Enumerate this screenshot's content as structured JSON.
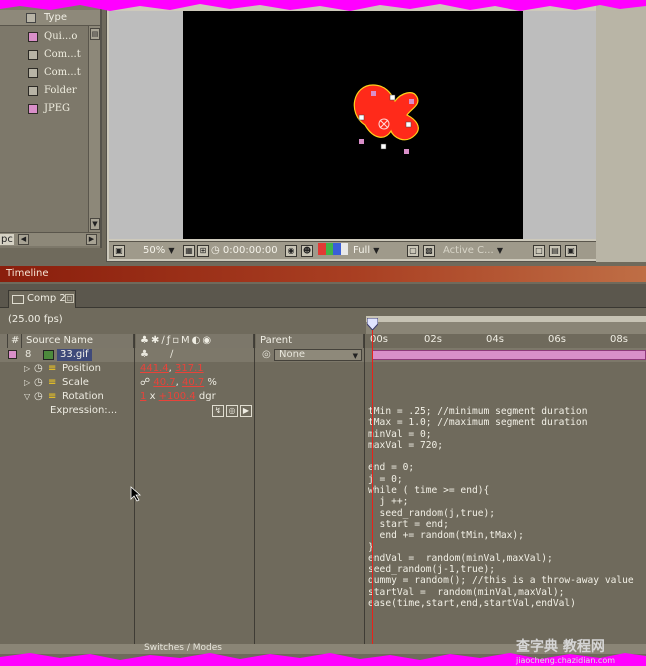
{
  "project": {
    "header_label": "Type",
    "items": [
      {
        "label": "Qui...o",
        "color": "#d98fc9"
      },
      {
        "label": "Com...t",
        "color": "#b7b3a5"
      },
      {
        "label": "Com...t",
        "color": "#b7b3a5"
      },
      {
        "label": "Folder",
        "color": "#b7b3a5"
      },
      {
        "label": "JPEG",
        "color": "#d98fc9"
      }
    ],
    "hscroll_text": "pc"
  },
  "viewer": {
    "zoom": "50%",
    "timecode": "0:00:00:00",
    "resolution": "Full",
    "camera": "Active C..."
  },
  "timeline": {
    "panel_title": "Timeline",
    "comp_tab": "Comp 2",
    "fps": "(25.00 fps)",
    "columns": {
      "number": "#",
      "source_name": "Source Name",
      "switches": "M",
      "parent": "Parent"
    },
    "time_ticks": [
      "00s",
      "02s",
      "04s",
      "06s",
      "08s"
    ],
    "layer": {
      "index": "8",
      "name": "33.gif",
      "parent": "None"
    },
    "properties": [
      {
        "name": "Position",
        "value1": "441.4",
        "value2": "317.1",
        "suffix": ""
      },
      {
        "name": "Scale",
        "value1": "40.7",
        "value2": "40.7",
        "suffix": "%"
      },
      {
        "name": "Rotation",
        "value1": "1",
        "value2": "+100.4",
        "suffix": "dgr"
      }
    ],
    "rotation_sep": "x",
    "expression_label": "Expression:...",
    "expression_lines": [
      "tMin = .25; //minimum segment duration",
      "tMax = 1.0; //maximum segment duration",
      "minVal = 0;",
      "maxVal = 720;",
      "",
      "end = 0;",
      "j = 0;",
      "while ( time >= end){",
      "  j ++;",
      "  seed_random(j,true);",
      "  start = end;",
      "  end += random(tMin,tMax);",
      "}",
      "endVal =  random(minVal,maxVal);",
      "seed_random(j-1,true);",
      "dummy = random(); //this is a throw-away value",
      "startVal =  random(minVal,maxVal);",
      "ease(time,start,end,startVal,endVal)"
    ],
    "bottom_label": "Switches / Modes"
  },
  "watermark": {
    "main": "查字典 教程网",
    "sub": "jiaocheng.chazidian.com"
  },
  "colors": {
    "accent_pink": "#ff00ff",
    "shape_red": "#ff2a1a",
    "value_red": "#e8433a",
    "layer_bar": "#d98fc9"
  }
}
